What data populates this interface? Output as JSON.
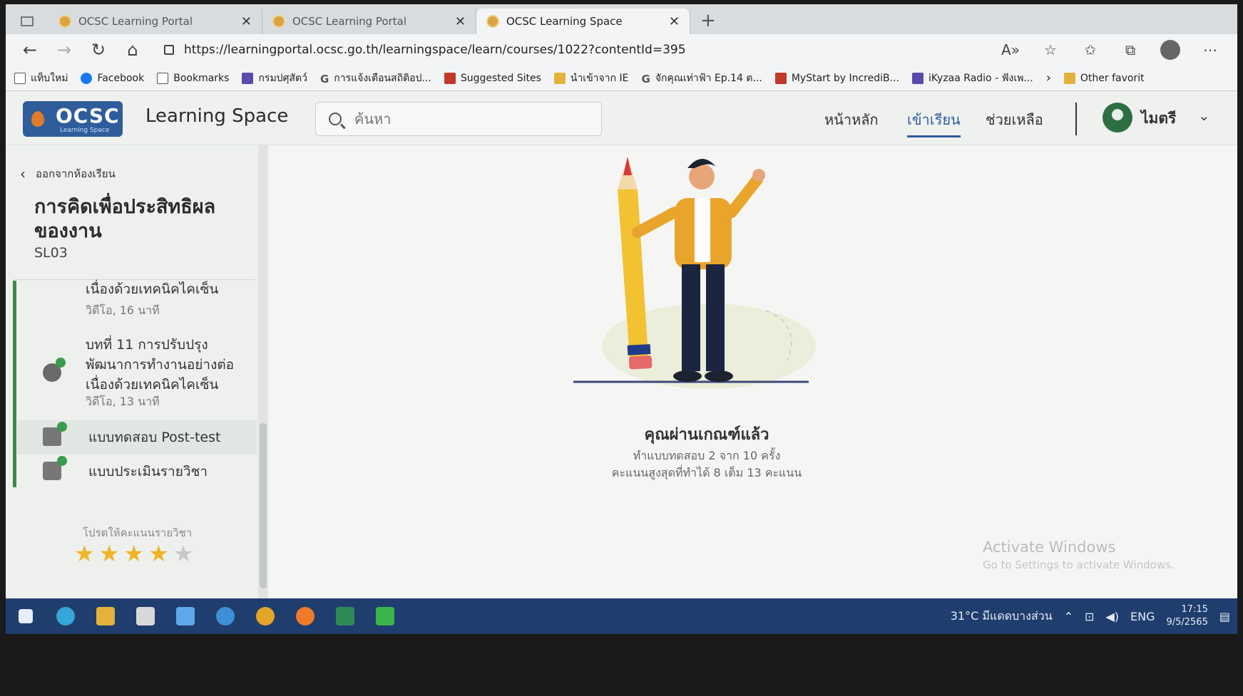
{
  "browser": {
    "tabs": [
      {
        "title": "OCSC Learning Portal",
        "active": false
      },
      {
        "title": "OCSC Learning Portal",
        "active": false
      },
      {
        "title": "OCSC Learning Space",
        "active": true
      }
    ],
    "url": "https://learningportal.ocsc.go.th/learningspace/learn/courses/1022?contentId=395",
    "bookmarks": [
      {
        "label": "แท็บใหม่",
        "icon": "page-icon"
      },
      {
        "label": "Facebook",
        "icon": "facebook-icon"
      },
      {
        "label": "Bookmarks",
        "icon": "page-icon"
      },
      {
        "label": "กรมปศุสัตว์",
        "icon": "site-icon"
      },
      {
        "label": "การแจ้งเตือนสถิติอป...",
        "icon": "google-icon"
      },
      {
        "label": "Suggested Sites",
        "icon": "site-icon"
      },
      {
        "label": "นำเข้าจาก IE",
        "icon": "folder-icon"
      },
      {
        "label": "จักคุณเท่าฟ้า Ep.14 ต...",
        "icon": "google-icon"
      },
      {
        "label": "MyStart by IncrediB...",
        "icon": "site-icon"
      },
      {
        "label": "iKyzaa Radio - ฟังเพ...",
        "icon": "site-icon"
      }
    ],
    "other_favorites": "Other favorit"
  },
  "header": {
    "logo_text": "OCSC",
    "logo_sub": "Learning Space",
    "brand": "Learning Space",
    "search_placeholder": "ค้นหา",
    "nav": [
      "หน้าหลัก",
      "เข้าเรียน",
      "ช่วยเหลือ"
    ],
    "active_nav": "เข้าเรียน",
    "user_name": "ไมตรี"
  },
  "sidebar": {
    "back_label": "ออกจากห้องเรียน",
    "course_title": "การคิดเพื่อประสิทธิผลของงาน",
    "course_code": "SL03",
    "items": [
      {
        "title": "เนื่องด้วยเทคนิคไคเซ็น",
        "meta": "วิดีโอ, 16 นาที",
        "type": "video"
      },
      {
        "title": "บทที่ 11 การปรับปรุงพัฒนาการทำงานอย่างต่อเนื่องด้วยเทคนิคไคเซ็น",
        "meta": "วิดีโอ, 13 นาที",
        "type": "video"
      },
      {
        "title": "แบบทดสอบ Post-test",
        "meta": "",
        "type": "quiz"
      },
      {
        "title": "แบบประเมินรายวิชา",
        "meta": "",
        "type": "survey"
      }
    ],
    "rating_label": "โปรดให้คะแนนรายวิชา",
    "rating": 4,
    "rating_max": 5
  },
  "result": {
    "title": "คุณผ่านเกณฑ์แล้ว",
    "attempts": "ทำแบบทดสอบ 2 จาก 10 ครั้ง",
    "score": "คะแนนสูงสุดที่ทำได้ 8 เต็ม 13 คะแนน"
  },
  "watermark": {
    "line1": "Activate Windows",
    "line2": "Go to Settings to activate Windows."
  },
  "taskbar": {
    "weather": "31°C มีแดดบางส่วน",
    "lang": "ENG",
    "time": "17:15",
    "date": "9/5/2565"
  },
  "colors": {
    "brand_blue": "#2f5d9c",
    "accent_green": "#3a8a4e",
    "star": "#f0b428",
    "taskbar": "#1f3e6e"
  }
}
